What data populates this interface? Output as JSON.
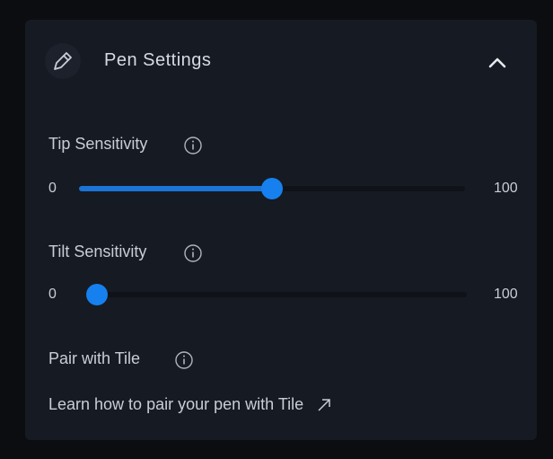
{
  "panel": {
    "title": "Pen Settings",
    "icons": {
      "pen": "pen-icon",
      "collapse": "chevron-up-icon",
      "info": "info-icon",
      "external": "external-link-icon"
    }
  },
  "tip_sensitivity": {
    "label": "Tip Sensitivity",
    "min_label": "0",
    "max_label": "100",
    "value": 50
  },
  "tilt_sensitivity": {
    "label": "Tilt Sensitivity",
    "min_label": "0",
    "max_label": "100",
    "value": 0
  },
  "pair": {
    "label": "Pair with Tile",
    "link_text": "Learn how to pair your pen with Tile"
  },
  "colors": {
    "accent": "#1680ee",
    "panel": "#161a22",
    "background": "#0b0d11",
    "text": "#c9ced6"
  }
}
